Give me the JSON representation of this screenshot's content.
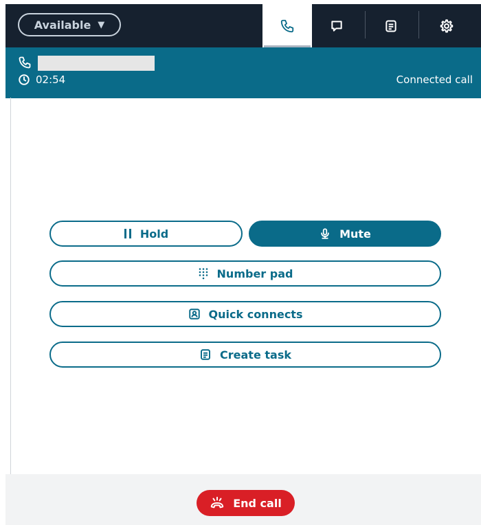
{
  "status": {
    "label": "Available",
    "caret": "▼"
  },
  "nav": {
    "tabs": [
      {
        "name": "phone-icon",
        "active": true
      },
      {
        "name": "chat-icon",
        "active": false
      },
      {
        "name": "task-list-icon",
        "active": false
      },
      {
        "name": "gear-icon",
        "active": false
      }
    ]
  },
  "call": {
    "timer": "02:54",
    "state": "Connected call"
  },
  "actions": {
    "hold": "Hold",
    "mute": "Mute",
    "number_pad": "Number pad",
    "quick_connects": "Quick connects",
    "create_task": "Create task"
  },
  "footer": {
    "end_call": "End call"
  },
  "colors": {
    "topbar": "#16212f",
    "accent": "#0a6b89",
    "end_call": "#d91f26",
    "footer_bg": "#f2f3f4"
  }
}
